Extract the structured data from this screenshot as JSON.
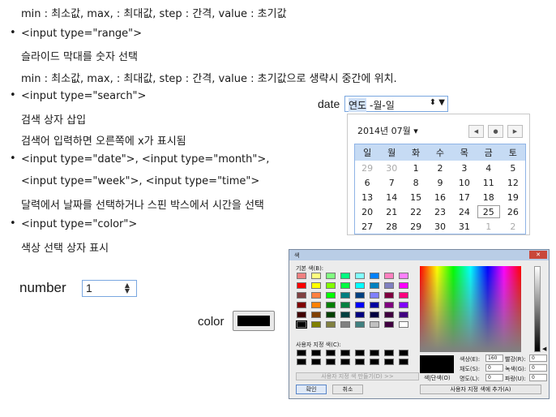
{
  "text": {
    "line0": "min : 최소값, max, : 최대값, step : 간격, value : 초기값",
    "range_type": "<input type=\"range\">",
    "range_desc": "슬라이드 막대를 숫자 선택",
    "range_params": "min : 최소값, max, : 최대값, step : 간격, value : 초기값으로 생략시 중간에 위치.",
    "search_type": "<input type=\"search\">",
    "search_desc1": "검색 상자 삽입",
    "search_desc2": "검색어   입력하면 오른쪽에 x가 표시됨",
    "date_type1": "<input type=\"date\">, <input type=\"month\">,",
    "date_type2": "<input type=\"week\">, <input type=\"time\">",
    "date_desc": "달력에서 날짜를 선택하거나 스핀 박스에서 시간을 선택",
    "color_type": "<input type=\"color\">",
    "color_desc": "색상 선택 상자 표시"
  },
  "number_demo": {
    "label": "number",
    "value": "1"
  },
  "color_demo": {
    "label": "color",
    "value_color": "#000000"
  },
  "date_demo": {
    "label": "date",
    "seg_year": "연도",
    "seg_rest": "-월-일",
    "spin": "⬍ ▼",
    "month_label": "2014년 07월 ▾",
    "nav_prev": "◀",
    "nav_today": "●",
    "nav_next": "▶",
    "weekdays": [
      "일",
      "월",
      "화",
      "수",
      "목",
      "금",
      "토"
    ],
    "weeks": [
      [
        "29",
        "30",
        "1",
        "2",
        "3",
        "4",
        "5"
      ],
      [
        "6",
        "7",
        "8",
        "9",
        "10",
        "11",
        "12"
      ],
      [
        "13",
        "14",
        "15",
        "16",
        "17",
        "18",
        "19"
      ],
      [
        "20",
        "21",
        "22",
        "23",
        "24",
        "25",
        "26"
      ],
      [
        "27",
        "28",
        "29",
        "30",
        "31",
        "1",
        "2"
      ]
    ]
  },
  "color_dialog": {
    "title": "색",
    "close": "✕",
    "basic_label": "기본 색(B):",
    "custom_label": "사용자 지정 색(C):",
    "make_custom": "사용자 지정 색 만들기(D) >>",
    "ok": "확인",
    "cancel": "취소",
    "preview_label": "색|단색(O)",
    "hue_label": "색상(E):",
    "hue": "160",
    "sat_label": "채도(S):",
    "sat": "0",
    "lum_label": "명도(L):",
    "lum": "0",
    "red_label": "빨강(R):",
    "red": "0",
    "green_label": "녹색(G):",
    "green": "0",
    "blue_label": "파랑(U):",
    "blue": "0",
    "add_custom": "사용자 지정 색에 추가(A)",
    "basic_colors": [
      [
        "#f08080",
        "#ffff80",
        "#80ff80",
        "#00ff80",
        "#80ffff",
        "#0080ff",
        "#ff80c0",
        "#ff80ff"
      ],
      [
        "#ff0000",
        "#ffff00",
        "#80ff00",
        "#00ff40",
        "#00ffff",
        "#0080c0",
        "#8080c0",
        "#ff00ff"
      ],
      [
        "#804040",
        "#ff8040",
        "#00ff00",
        "#008080",
        "#004080",
        "#8080ff",
        "#800040",
        "#ff0080"
      ],
      [
        "#800000",
        "#ff8000",
        "#008000",
        "#008040",
        "#0000ff",
        "#0000a0",
        "#800080",
        "#8000ff"
      ],
      [
        "#400000",
        "#804000",
        "#004000",
        "#004040",
        "#000080",
        "#000040",
        "#400040",
        "#400080"
      ],
      [
        "#000000",
        "#808000",
        "#808040",
        "#808080",
        "#408080",
        "#c0c0c0",
        "#400040",
        "#ffffff"
      ]
    ]
  }
}
